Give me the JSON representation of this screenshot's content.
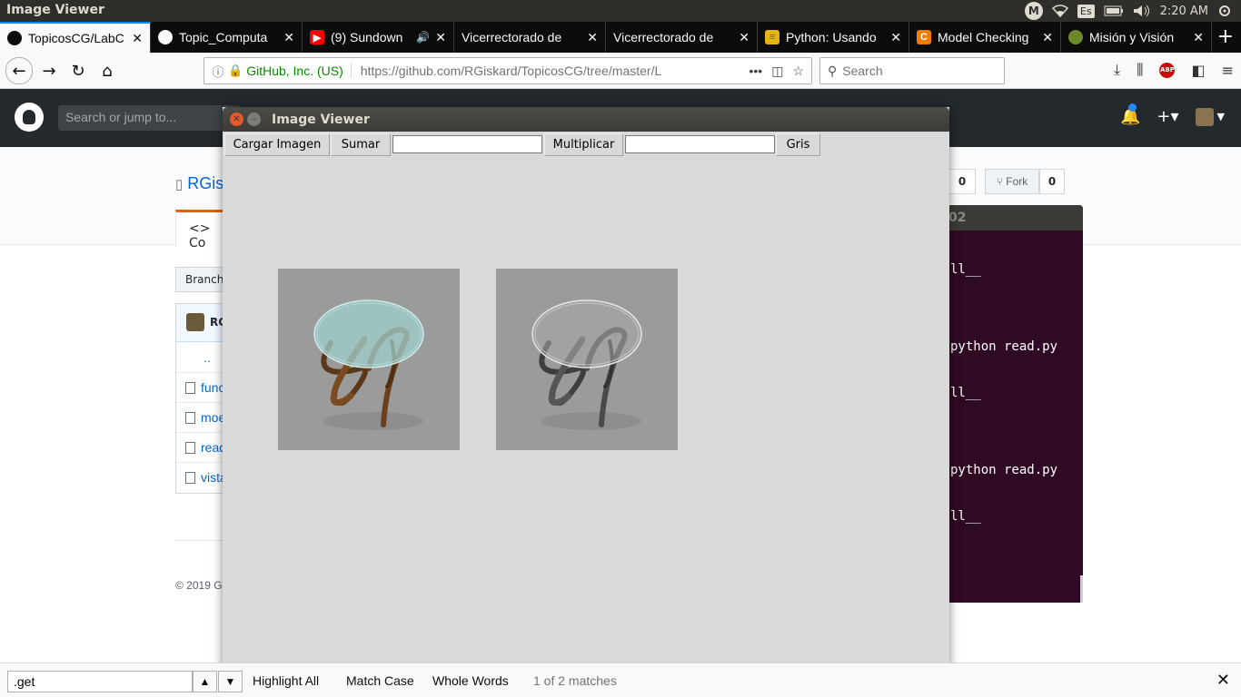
{
  "panel": {
    "active_app": "Image Viewer",
    "mail_badge": "M",
    "keyboard_layout": "Es",
    "clock": "2:20 AM"
  },
  "browser": {
    "tabs": [
      {
        "title": "TopicosCG/LabC",
        "favicon": "github",
        "active": true
      },
      {
        "title": "Topic_Computa",
        "favicon": "github"
      },
      {
        "title": "(9) Sundown",
        "favicon": "youtube",
        "audio": true
      },
      {
        "title": "Vicerrectorado de",
        "favicon": "none"
      },
      {
        "title": "Vicerrectorado de",
        "favicon": "none"
      },
      {
        "title": "Python: Usando",
        "favicon": "yellow"
      },
      {
        "title": "Model Checking",
        "favicon": "orange-c"
      },
      {
        "title": "Misión y Visión",
        "favicon": "green"
      }
    ],
    "identity": "GitHub, Inc. (US)",
    "url": "https://github.com/RGiskard/TopicosCG/tree/master/L",
    "search_placeholder": "Search"
  },
  "github": {
    "search_placeholder": "Search or jump to...",
    "repo_owner": "RGis",
    "code_tab": "Co",
    "branch_label": "Branch:",
    "star_count": "0",
    "fork_label": "Fork",
    "fork_count": "0",
    "commit_author": "RG",
    "files": [
      "..",
      "func",
      "moe",
      "read",
      "vista"
    ],
    "copyright": "© 2019 G"
  },
  "terminal": {
    "title_fragment": "02",
    "lines": [
      "ll__",
      "python read.py",
      "ll__",
      "python read.py",
      "ll__"
    ]
  },
  "viewer": {
    "title": "Image Viewer",
    "buttons": {
      "load": "Cargar Imagen",
      "add": "Sumar",
      "multiply": "Multiplicar",
      "gray": "Gris"
    },
    "add_value": "",
    "multiply_value": "",
    "images": [
      "original-color-table",
      "grayscale-table"
    ],
    "colors": {
      "titlebar": "#3c3b37",
      "window_bg": "#d9d9d9",
      "image_bg": "#9b9b9b",
      "glass": "#9fcfcc",
      "wood": "#7a4a22"
    }
  },
  "findbar": {
    "query": ".get",
    "highlight_all": "Highlight All",
    "match_case": "Match Case",
    "whole_words": "Whole Words",
    "result": "1 of 2 matches"
  }
}
